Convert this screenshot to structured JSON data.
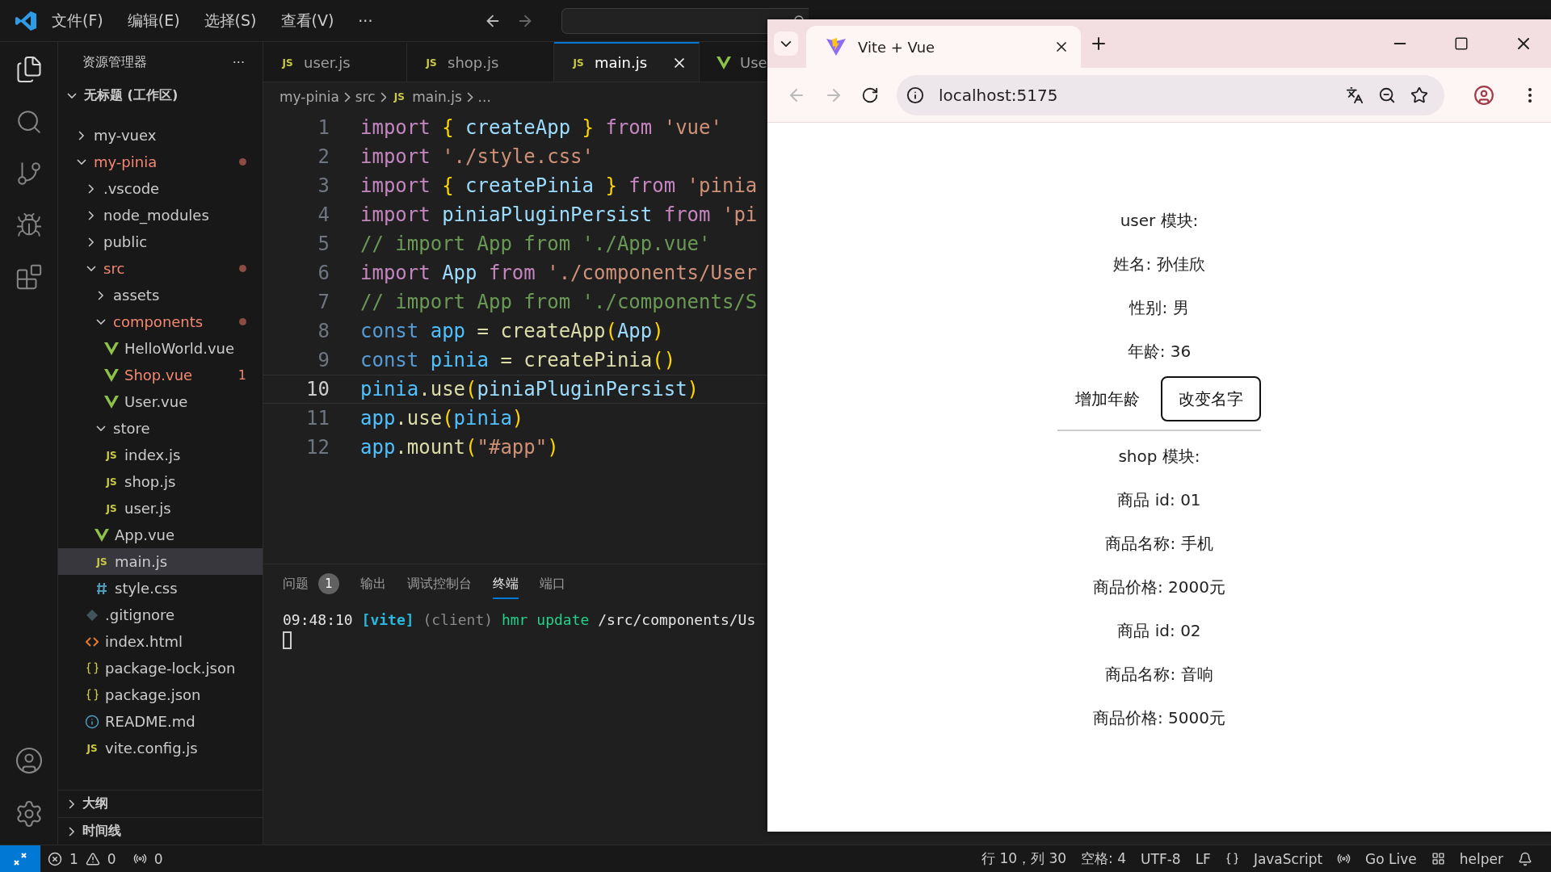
{
  "menu": [
    "文件(F)",
    "编辑(E)",
    "选择(S)",
    "查看(V)",
    "···"
  ],
  "explorer": {
    "title": "资源管理器",
    "more": "···",
    "workspace": "无标题 (工作区)",
    "tree": [
      {
        "label": "my-vuex",
        "kind": "folder",
        "expanded": false,
        "selected": false
      },
      {
        "label": "my-pinia",
        "kind": "folder",
        "expanded": true,
        "modified": true,
        "selected": false,
        "children": [
          {
            "label": ".vscode",
            "kind": "folder",
            "expanded": false,
            "selected": false
          },
          {
            "label": "node_modules",
            "kind": "folder",
            "expanded": false,
            "selected": false
          },
          {
            "label": "public",
            "kind": "folder",
            "expanded": false,
            "selected": false
          },
          {
            "label": "src",
            "kind": "folder",
            "expanded": true,
            "modified": true,
            "selected": false,
            "children": [
              {
                "label": "assets",
                "kind": "folder",
                "expanded": false,
                "selected": false
              },
              {
                "label": "components",
                "kind": "folder",
                "expanded": true,
                "modified": true,
                "selected": false,
                "children": [
                  {
                    "label": "HelloWorld.vue",
                    "kind": "vue",
                    "selected": false
                  },
                  {
                    "label": "Shop.vue",
                    "kind": "vue",
                    "modified": true,
                    "badge": "1",
                    "selected": false
                  },
                  {
                    "label": "User.vue",
                    "kind": "vue",
                    "selected": false
                  }
                ]
              },
              {
                "label": "store",
                "kind": "folder",
                "expanded": true,
                "selected": false,
                "children": [
                  {
                    "label": "index.js",
                    "kind": "js",
                    "icon": "JS",
                    "selected": false
                  },
                  {
                    "label": "shop.js",
                    "kind": "js",
                    "icon": "JS",
                    "selected": false
                  },
                  {
                    "label": "user.js",
                    "kind": "js",
                    "icon": "JS",
                    "selected": false
                  }
                ]
              },
              {
                "label": "App.vue",
                "kind": "vue",
                "selected": false
              },
              {
                "label": "main.js",
                "kind": "js",
                "icon": "JS",
                "selected": true
              },
              {
                "label": "style.css",
                "kind": "css",
                "selected": false
              }
            ]
          },
          {
            "label": ".gitignore",
            "kind": "git",
            "selected": false
          },
          {
            "label": "index.html",
            "kind": "html",
            "selected": false
          },
          {
            "label": "package-lock.json",
            "kind": "json",
            "selected": false
          },
          {
            "label": "package.json",
            "kind": "json",
            "selected": false
          },
          {
            "label": "README.md",
            "kind": "info",
            "selected": false
          },
          {
            "label": "vite.config.js",
            "kind": "js",
            "icon": "JS",
            "selected": false
          }
        ]
      }
    ],
    "sections": [
      "大纲",
      "时间线"
    ]
  },
  "editor_tabs": [
    {
      "label": "user.js",
      "kind": "js",
      "icon": "JS",
      "selected": false
    },
    {
      "label": "shop.js",
      "kind": "js",
      "icon": "JS",
      "selected": false
    },
    {
      "label": "main.js",
      "kind": "js",
      "icon": "JS",
      "selected": true
    },
    {
      "label": "Use",
      "kind": "vue",
      "selected": false
    }
  ],
  "breadcrumb": [
    {
      "label": "my-pinia",
      "kind": "folder"
    },
    {
      "label": "src",
      "kind": "folder"
    },
    {
      "label": "main.js",
      "kind": "js",
      "icon": "JS"
    },
    {
      "label": "...",
      "kind": "folder"
    }
  ],
  "code": [
    {
      "number": "1",
      "selected": false,
      "tokens": [
        {
          "text": "import",
          "kind": "kw"
        },
        {
          "text": " {",
          "kind": "br"
        },
        {
          "text": " createApp ",
          "kind": "var"
        },
        {
          "text": "}",
          "kind": "br"
        },
        {
          "text": " from ",
          "kind": "kw"
        },
        {
          "text": "'vue'",
          "kind": "str"
        }
      ]
    },
    {
      "number": "2",
      "selected": false,
      "tokens": [
        {
          "text": "import",
          "kind": "kw"
        },
        {
          "text": " './style.css'",
          "kind": "str"
        }
      ]
    },
    {
      "number": "3",
      "selected": false,
      "tokens": [
        {
          "text": "import",
          "kind": "kw"
        },
        {
          "text": " {",
          "kind": "br"
        },
        {
          "text": " createPinia ",
          "kind": "var"
        },
        {
          "text": "}",
          "kind": "br"
        },
        {
          "text": " from ",
          "kind": "kw"
        },
        {
          "text": "'pinia",
          "kind": "str"
        }
      ]
    },
    {
      "number": "4",
      "selected": false,
      "tokens": [
        {
          "text": "import",
          "kind": "kw"
        },
        {
          "text": " piniaPluginPersist ",
          "kind": "var"
        },
        {
          "text": "from",
          "kind": "kw"
        },
        {
          "text": " 'pi",
          "kind": "str"
        }
      ]
    },
    {
      "number": "5",
      "selected": false,
      "tokens": [
        {
          "text": "// import App from './App.vue'",
          "kind": "cm"
        }
      ]
    },
    {
      "number": "6",
      "selected": false,
      "tokens": [
        {
          "text": "import",
          "kind": "kw"
        },
        {
          "text": " App ",
          "kind": "var"
        },
        {
          "text": "from",
          "kind": "kw"
        },
        {
          "text": " './components/User",
          "kind": "str"
        }
      ]
    },
    {
      "number": "7",
      "selected": false,
      "tokens": [
        {
          "text": "// import App from './components/S",
          "kind": "cm"
        }
      ]
    },
    {
      "number": "8",
      "selected": false,
      "tokens": [
        {
          "text": "const",
          "kind": "decl"
        },
        {
          "text": " app",
          "kind": "const"
        },
        {
          "text": " = createApp",
          "kind": "fn"
        },
        {
          "text": "(",
          "kind": "br"
        },
        {
          "text": "App",
          "kind": "var"
        },
        {
          "text": ")",
          "kind": "br"
        }
      ]
    },
    {
      "number": "9",
      "selected": false,
      "tokens": [
        {
          "text": "const",
          "kind": "decl"
        },
        {
          "text": " pinia",
          "kind": "const"
        },
        {
          "text": " = createPinia",
          "kind": "fn"
        },
        {
          "text": "()",
          "kind": "br"
        }
      ]
    },
    {
      "number": "10",
      "selected": true,
      "tokens": [
        {
          "text": "pinia",
          "kind": "const"
        },
        {
          "text": ".use",
          "kind": "fn"
        },
        {
          "text": "(",
          "kind": "br"
        },
        {
          "text": "piniaPluginPersist",
          "kind": "var"
        },
        {
          "text": ")",
          "kind": "br"
        }
      ]
    },
    {
      "number": "11",
      "selected": false,
      "tokens": [
        {
          "text": "app",
          "kind": "const"
        },
        {
          "text": ".use",
          "kind": "fn"
        },
        {
          "text": "(",
          "kind": "br"
        },
        {
          "text": "pinia",
          "kind": "const"
        },
        {
          "text": ")",
          "kind": "br"
        }
      ]
    },
    {
      "number": "12",
      "selected": false,
      "tokens": [
        {
          "text": "app",
          "kind": "const"
        },
        {
          "text": ".mount",
          "kind": "fn"
        },
        {
          "text": "(",
          "kind": "br"
        },
        {
          "text": "\"#app\"",
          "kind": "str"
        },
        {
          "text": ")",
          "kind": "br"
        }
      ]
    }
  ],
  "panel": {
    "tabs": [
      {
        "label": "问题",
        "badge": "1",
        "selected": false
      },
      {
        "label": "输出",
        "selected": false
      },
      {
        "label": "调试控制台",
        "selected": false
      },
      {
        "label": "终端",
        "selected": true
      },
      {
        "label": "端口",
        "selected": false
      }
    ],
    "terminal": [
      {
        "text": "09:48:10",
        "kind": "time"
      },
      {
        "text": " [vite]",
        "kind": "tag"
      },
      {
        "text": " (client)",
        "kind": "dim"
      },
      {
        "text": " hmr update",
        "kind": "ok"
      },
      {
        "text": " /src/components/Us",
        "kind": "path"
      }
    ]
  },
  "status_bar": {
    "errors": "1",
    "warnings": "0",
    "ports": "0",
    "items": [
      {
        "label": "行 10，列 30",
        "kind": "text"
      },
      {
        "label": "空格: 4",
        "kind": "text"
      },
      {
        "label": "UTF-8",
        "kind": "text"
      },
      {
        "label": "LF",
        "kind": "text"
      },
      {
        "label": "JavaScript",
        "kind": "braces"
      },
      {
        "label": "Go Live",
        "kind": "live"
      },
      {
        "label": "helper",
        "kind": "layout"
      },
      {
        "kind": "bell"
      }
    ]
  },
  "browser": {
    "tab": {
      "title": "Vite + Vue",
      "selected": true
    },
    "address": "localhost:5175",
    "content": [
      {
        "kind": "text",
        "label": "user 模块:"
      },
      {
        "kind": "text",
        "label": "姓名: 孙佳欣"
      },
      {
        "kind": "text",
        "label": "性别: 男"
      },
      {
        "kind": "text",
        "label": "年龄: 36"
      },
      {
        "kind": "buttons",
        "buttons": [
          {
            "label": "增加年龄",
            "focused": false
          },
          {
            "label": "改变名字",
            "focused": true
          }
        ]
      },
      {
        "kind": "text",
        "label": "shop 模块:"
      },
      {
        "kind": "text",
        "label": "商品 id: 01"
      },
      {
        "kind": "text",
        "label": "商品名称: 手机"
      },
      {
        "kind": "text",
        "label": "商品价格: 2000元"
      },
      {
        "kind": "text",
        "label": "商品 id: 02"
      },
      {
        "kind": "text",
        "label": "商品名称: 音响"
      },
      {
        "kind": "text",
        "label": "商品价格: 5000元"
      }
    ]
  }
}
